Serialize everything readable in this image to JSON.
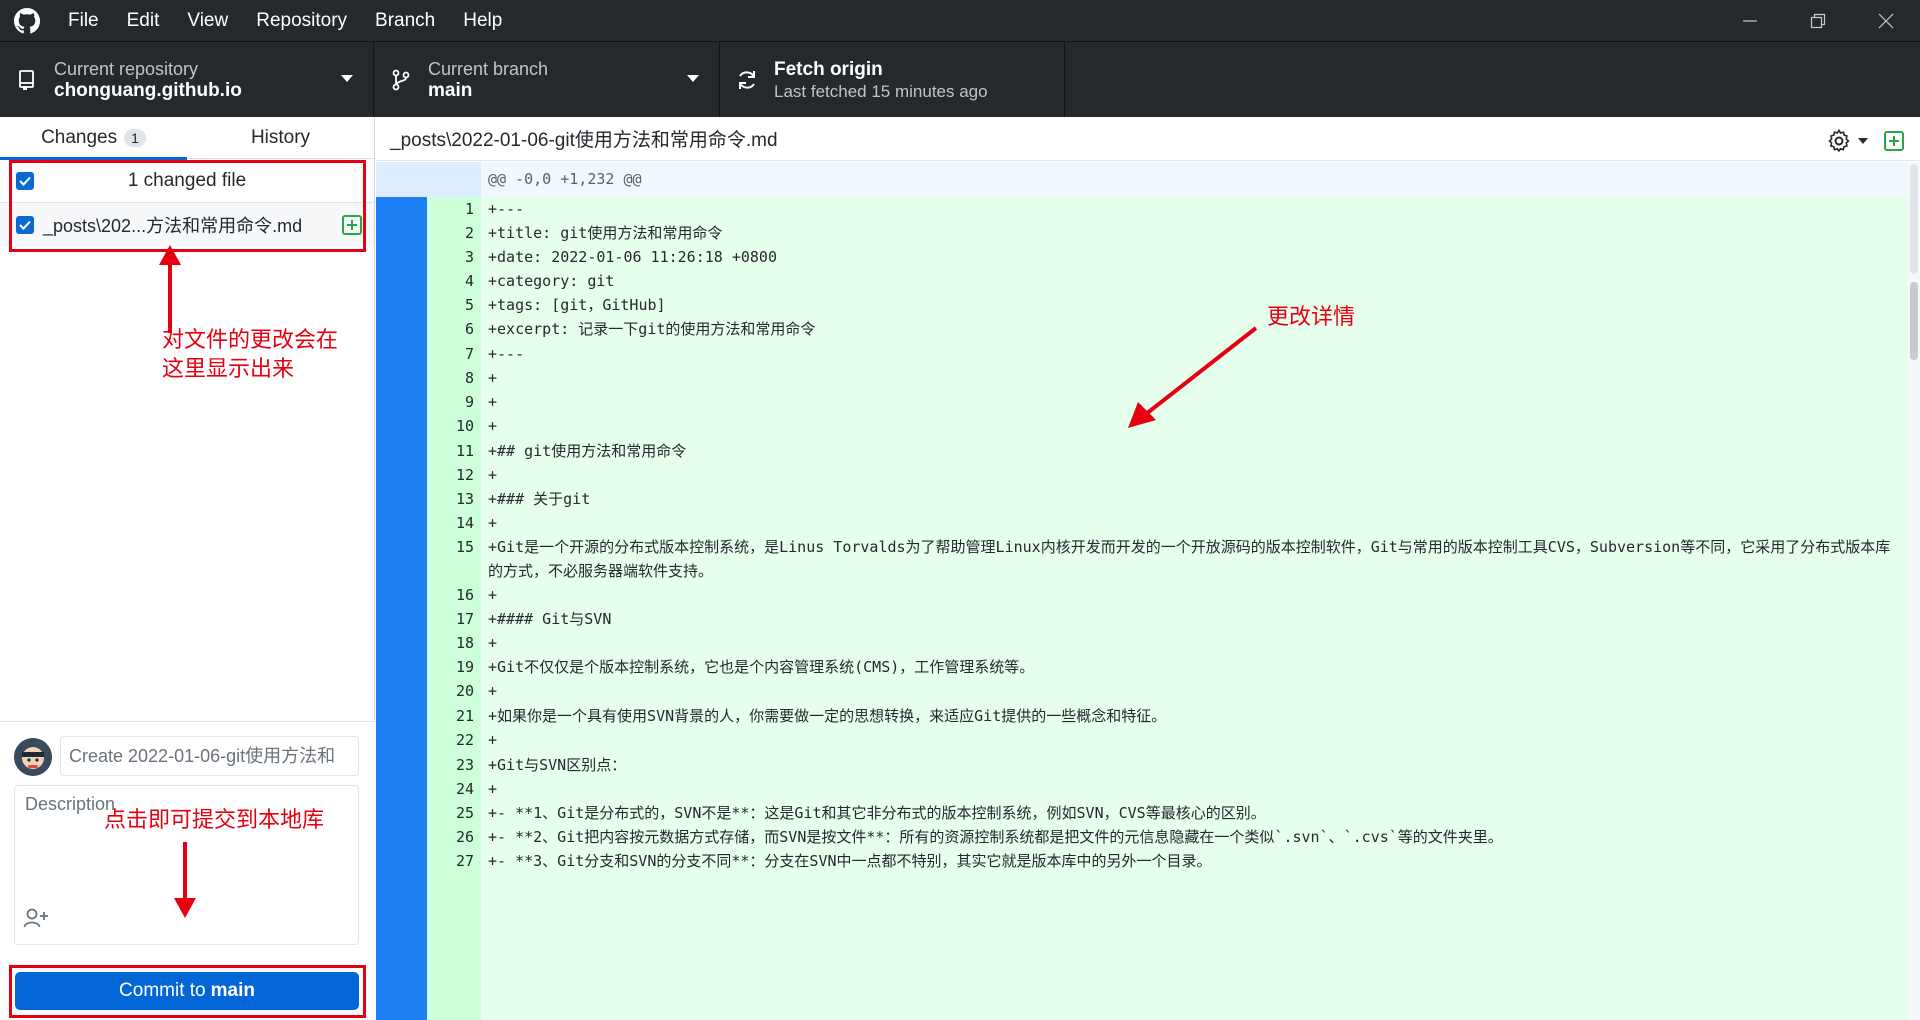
{
  "menu": [
    "File",
    "Edit",
    "View",
    "Repository",
    "Branch",
    "Help"
  ],
  "toolbar": {
    "repo_label": "Current repository",
    "repo_value": "chonguang.github.io",
    "branch_label": "Current branch",
    "branch_value": "main",
    "fetch_title": "Fetch origin",
    "fetch_sub": "Last fetched 15 minutes ago"
  },
  "sidebar": {
    "tab_changes": "Changes",
    "tab_changes_count": "1",
    "tab_history": "History",
    "changes_header": "1 changed file",
    "file_name": "_posts\\202...方法和常用命令.md",
    "summary_placeholder": "Create 2022-01-06-git使用方法和",
    "description_placeholder": "Description",
    "commit_prefix": "Commit to",
    "commit_branch": "main"
  },
  "annotations": {
    "sidebar_note_1": "对文件的更改会在",
    "sidebar_note_2": "这里显示出来",
    "diff_note": "更改详情",
    "commit_note": "点击即可提交到本地库"
  },
  "diff": {
    "path": "_posts\\2022-01-06-git使用方法和常用命令.md",
    "hunk": "@@ -0,0 +1,232 @@",
    "lines": [
      {
        "n": "1",
        "text": "+---"
      },
      {
        "n": "2",
        "text": "+title: git使用方法和常用命令"
      },
      {
        "n": "3",
        "text": "+date: 2022-01-06 11:26:18 +0800"
      },
      {
        "n": "4",
        "text": "+category: git"
      },
      {
        "n": "5",
        "text": "+tags: [git，GitHub]"
      },
      {
        "n": "6",
        "text": "+excerpt: 记录一下git的使用方法和常用命令"
      },
      {
        "n": "7",
        "text": "+---"
      },
      {
        "n": "8",
        "text": "+"
      },
      {
        "n": "9",
        "text": "+"
      },
      {
        "n": "10",
        "text": "+"
      },
      {
        "n": "11",
        "text": "+## git使用方法和常用命令"
      },
      {
        "n": "12",
        "text": "+"
      },
      {
        "n": "13",
        "text": "+### 关于git"
      },
      {
        "n": "14",
        "text": "+"
      },
      {
        "n": "15",
        "text": "+Git是一个开源的分布式版本控制系统，是Linus Torvalds为了帮助管理Linux内核开发而开发的一个开放源码的版本控制软件，Git与常用的版本控制工具CVS，Subversion等不同，它采用了分布式版本库的方式，不必服务器端软件支持。"
      },
      {
        "n": "16",
        "text": "+"
      },
      {
        "n": "17",
        "text": "+#### Git与SVN"
      },
      {
        "n": "18",
        "text": "+"
      },
      {
        "n": "19",
        "text": "+Git不仅仅是个版本控制系统，它也是个内容管理系统(CMS)，工作管理系统等。"
      },
      {
        "n": "20",
        "text": "+"
      },
      {
        "n": "21",
        "text": "+如果你是一个具有使用SVN背景的人，你需要做一定的思想转换，来适应Git提供的一些概念和特征。"
      },
      {
        "n": "22",
        "text": "+"
      },
      {
        "n": "23",
        "text": "+Git与SVN区别点："
      },
      {
        "n": "24",
        "text": "+"
      },
      {
        "n": "25",
        "text": "+- **1、Git是分布式的，SVN不是**：这是Git和其它非分布式的版本控制系统，例如SVN，CVS等最核心的区别。"
      },
      {
        "n": "26",
        "text": "+- **2、Git把内容按元数据方式存储，而SVN是按文件**：所有的资源控制系统都是把文件的元信息隐藏在一个类似`.svn`、`.cvs`等的文件夹里。"
      },
      {
        "n": "27",
        "text": "+- **3、Git分支和SVN的分支不同**：分支在SVN中一点都不特别，其实它就是版本库中的另外一个目录。"
      }
    ]
  },
  "colors": {
    "titlebar": "#24292e",
    "accent": "#0366d6",
    "annotation": "#e60012",
    "added_line_bg": "#e6ffed"
  }
}
